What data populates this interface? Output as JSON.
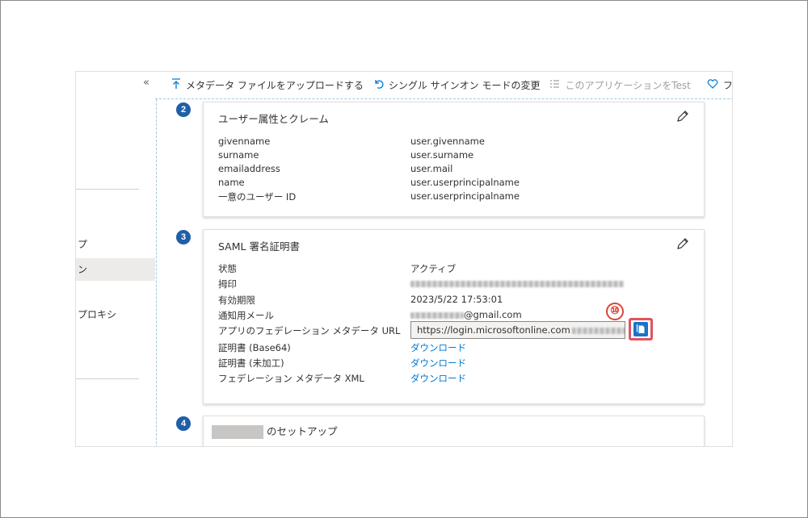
{
  "left_nav": {
    "collapse_glyph": "«",
    "items": [
      {
        "label": "プ",
        "active": false
      },
      {
        "label": "ン",
        "active": true
      },
      {
        "label": "プロキシ",
        "active": false
      }
    ]
  },
  "toolbar": {
    "upload_metadata": {
      "label": "メタデータ ファイルをアップロードする",
      "icon": "upload-icon"
    },
    "change_mode": {
      "label": "シングル サインオン モードの変更",
      "icon": "undo-icon"
    },
    "test_app": {
      "label": "このアプリケーションをTest",
      "icon": "list-icon",
      "disabled": true
    },
    "feedback": {
      "label": "フ",
      "icon": "heart-icon"
    }
  },
  "sections": {
    "attributes": {
      "step": "2",
      "title": "ユーザー属性とクレーム",
      "rows": [
        {
          "key": "givenname",
          "value": "user.givenname"
        },
        {
          "key": "surname",
          "value": "user.surname"
        },
        {
          "key": "emailaddress",
          "value": "user.mail"
        },
        {
          "key": "name",
          "value": "user.userprincipalname"
        },
        {
          "key": "一意のユーザー ID",
          "value": "user.userprincipalname"
        }
      ]
    },
    "certificate": {
      "step": "3",
      "title": "SAML 署名証明書",
      "status_label": "状態",
      "status_value": "アクティブ",
      "thumbprint_label": "拇印",
      "expiry_label": "有効期限",
      "expiry_value": "2023/5/22 17:53:01",
      "email_label": "通知用メール",
      "email_suffix": "@gmail.com",
      "metadata_url_label": "アプリのフェデレーション メタデータ URL",
      "metadata_url_value": "https://login.microsoftonline.com",
      "cert_base64_label": "証明書 (Base64)",
      "cert_base64_link": "ダウンロード",
      "cert_raw_label": "証明書 (未加工)",
      "cert_raw_link": "ダウンロード",
      "fed_xml_label": "フェデレーション メタデータ XML",
      "fed_xml_link": "ダウンロード"
    },
    "setup": {
      "step": "4",
      "title_suffix": "のセットアップ"
    }
  },
  "annotation": {
    "marker": "⑩"
  }
}
